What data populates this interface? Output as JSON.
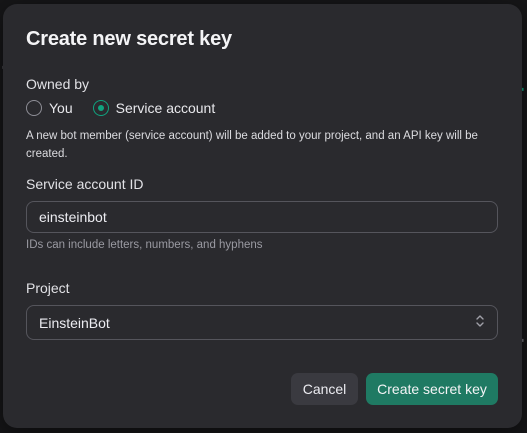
{
  "dialog": {
    "title": "Create new secret key",
    "owned_by": {
      "label": "Owned by",
      "options": [
        {
          "label": "You",
          "selected": false
        },
        {
          "label": "Service account",
          "selected": true
        }
      ],
      "note": "A new bot member (service account) will be added to your project, and an API key will be created."
    },
    "service_account": {
      "label": "Service account ID",
      "value": "einsteinbot",
      "hint": "IDs can include letters, numbers, and hyphens"
    },
    "project": {
      "label": "Project",
      "value": "EinsteinBot"
    },
    "actions": {
      "cancel": "Cancel",
      "create": "Create secret key"
    }
  },
  "colors": {
    "accent": "#10a37f",
    "primary_button": "#1f7a63",
    "modal_bg": "#2a2a2e"
  }
}
